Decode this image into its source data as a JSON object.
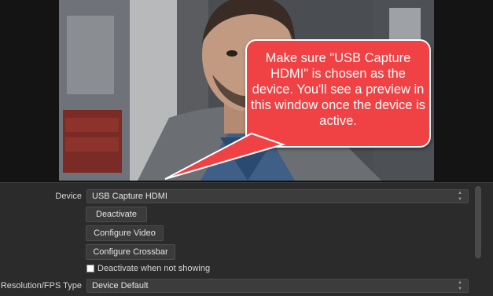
{
  "callout": {
    "text": "Make sure \"USB Capture HDMI\" is chosen as the device. You'll see a preview in this window once the device is active."
  },
  "properties": {
    "device_label": "Device",
    "device_value": "USB Capture HDMI",
    "deactivate_button": "Deactivate",
    "configure_video_button": "Configure Video",
    "configure_crossbar_button": "Configure Crossbar",
    "deactivate_when_not_showing_label": "Deactivate when not showing",
    "deactivate_when_not_showing_checked": false,
    "resolution_label": "Resolution/FPS Type",
    "resolution_value": "Device Default"
  },
  "colors": {
    "callout_fill": "#f04144",
    "panel_bg": "#2b2b2b",
    "combo_bg": "#3c3c3c"
  }
}
